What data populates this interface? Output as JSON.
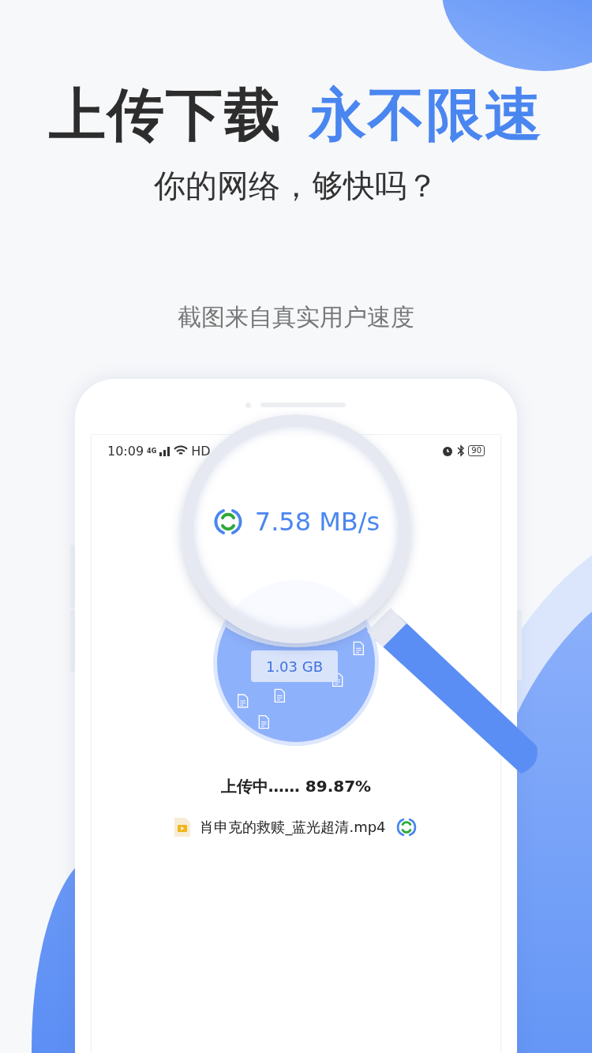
{
  "headline": {
    "part_1": "上传下载",
    "part_2": "永不限速"
  },
  "subtitle": "你的网络，够快吗？",
  "caption": "截图来自真实用户速度",
  "phone": {
    "status_bar": {
      "time": "10:09",
      "network": "4G",
      "wifi_label": "HD",
      "battery": "90"
    },
    "speed": "7.58 MB/s",
    "total_size": "1.03 GB",
    "upload_status": "上传中…… 89.87%",
    "file": {
      "name": "肖申克的救赎_蓝光超清.mp4"
    }
  }
}
